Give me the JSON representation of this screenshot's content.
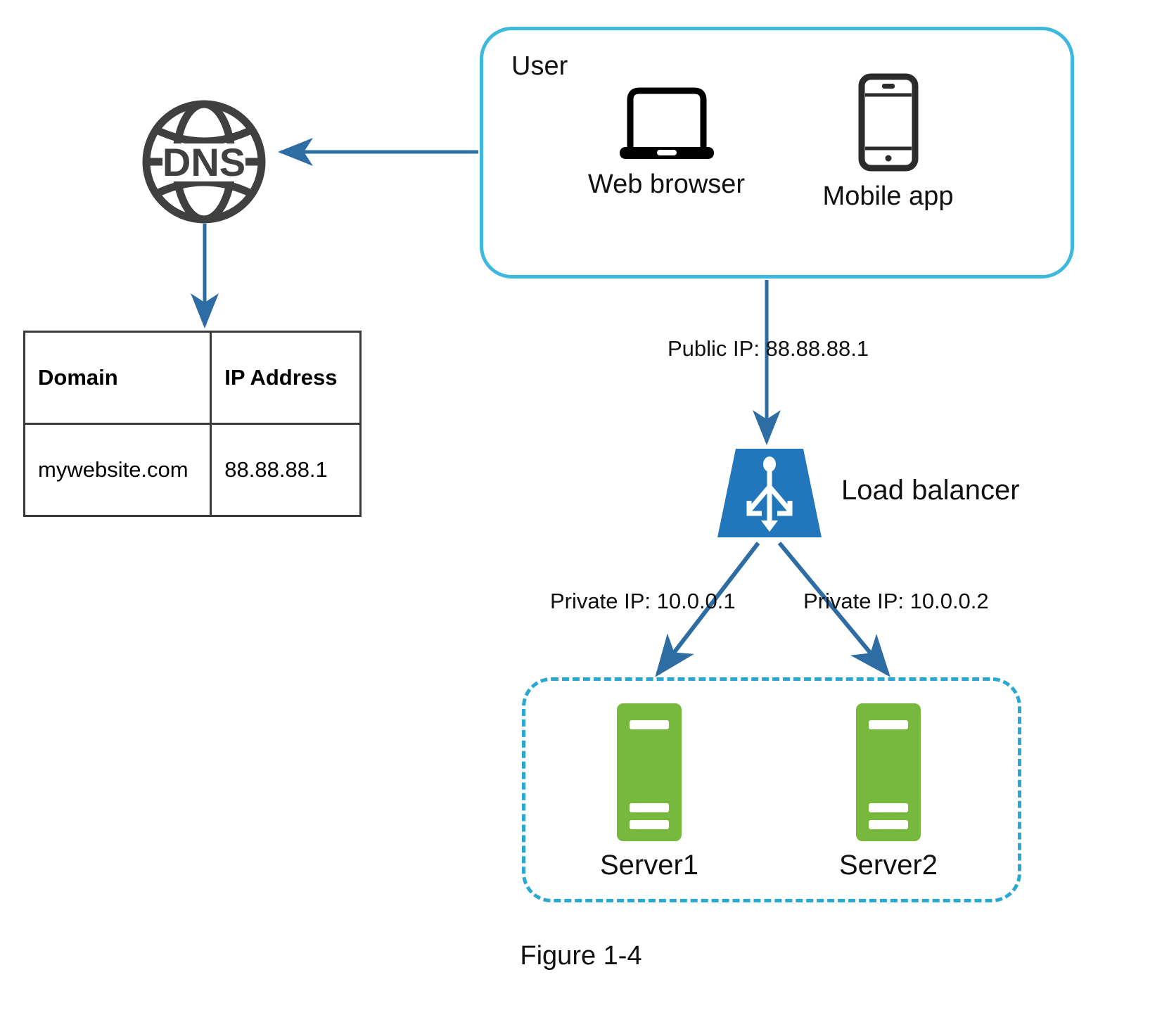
{
  "figure": {
    "caption": "Figure 1-4"
  },
  "dns": {
    "node_label": "DNS",
    "icon": "globe-icon",
    "color": "#404040"
  },
  "dns_table": {
    "columns": [
      "Domain",
      "IP Address"
    ],
    "rows": [
      [
        "mywebsite.com",
        "88.88.88.1"
      ]
    ],
    "border_color": "#3a3a3a"
  },
  "user": {
    "title": "User",
    "border_color": "#3FB8DE",
    "clients": [
      {
        "label": "Web browser",
        "icon": "laptop-icon"
      },
      {
        "label": "Mobile app",
        "icon": "smartphone-icon"
      }
    ]
  },
  "load_balancer": {
    "label": "Load balancer",
    "icon": "load-balancer-distribute-icon",
    "color": "#2176BC"
  },
  "server_group": {
    "border_color": "#2BA8D1",
    "servers": [
      {
        "label": "Server1",
        "icon": "server-icon",
        "color": "#76B93D"
      },
      {
        "label": "Server2",
        "icon": "server-icon",
        "color": "#76B93D"
      }
    ]
  },
  "edges": {
    "public_ip_label": "Public IP: 88.88.88.1",
    "private_ip_label_1": "Private IP: 10.0.0.1",
    "private_ip_label_2": "Private IP: 10.0.0.2",
    "arrow_color": "#2E6DA4"
  }
}
